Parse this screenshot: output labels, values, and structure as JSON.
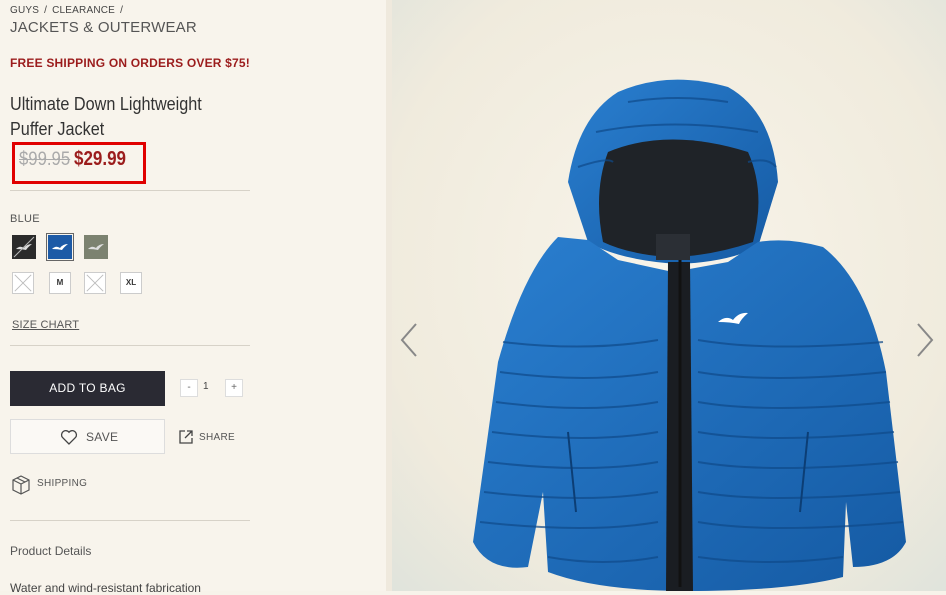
{
  "breadcrumb": {
    "items": [
      "GUYS",
      "CLEARANCE"
    ],
    "separator": "/"
  },
  "category_title": "JACKETS & OUTERWEAR",
  "promo": "FREE SHIPPING ON ORDERS OVER $75!",
  "product": {
    "name_line1": "Ultimate Down Lightweight",
    "name_line2": "Puffer Jacket",
    "price_original": "$99.95",
    "price_sale": "$29.99"
  },
  "color": {
    "selected_label": "BLUE",
    "swatches": [
      {
        "name": "black",
        "color": "#2b2b2b"
      },
      {
        "name": "blue",
        "color": "#1d5aa6",
        "selected": true
      },
      {
        "name": "olive",
        "color": "#7c8270"
      }
    ]
  },
  "sizes": [
    {
      "label": "",
      "available": false
    },
    {
      "label": "M",
      "available": true
    },
    {
      "label": "",
      "available": false
    },
    {
      "label": "XL",
      "available": true
    }
  ],
  "size_chart_label": "SIZE CHART",
  "actions": {
    "add_to_bag": "ADD TO BAG",
    "qty_minus": "-",
    "qty_value": "1",
    "qty_plus": "+",
    "save": "SAVE",
    "share": "SHARE",
    "shipping": "SHIPPING"
  },
  "details": {
    "title": "Product Details",
    "text": "Water and wind-resistant fabrication"
  },
  "gallery": {
    "prev_icon": "chevron-left-icon",
    "next_icon": "chevron-right-icon",
    "jacket_color": "#1a68b8"
  },
  "colors": {
    "accent_red": "#9b1c1c",
    "highlight_box": "#e00000",
    "button_dark": "#2a2a33"
  }
}
